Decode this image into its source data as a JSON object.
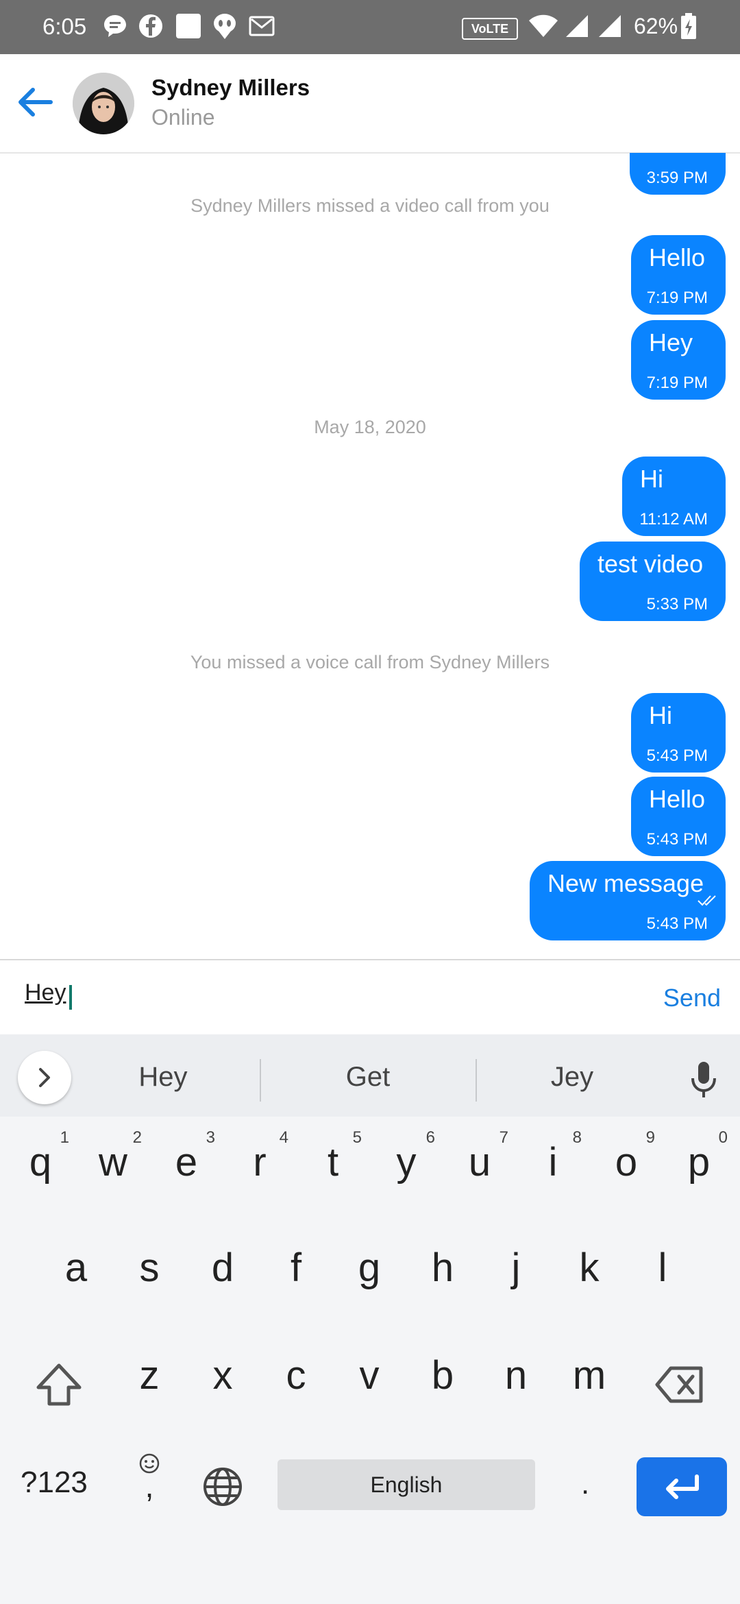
{
  "status_bar": {
    "time": "6:05",
    "network_badge": "VoLTE",
    "battery": "62%"
  },
  "header": {
    "contact_name": "Sydney Millers",
    "contact_status": "Online"
  },
  "chat": {
    "items": [
      {
        "kind": "out",
        "text": "",
        "time": "3:59 PM"
      },
      {
        "kind": "system",
        "text": "Sydney Millers missed a video call from you"
      },
      {
        "kind": "out",
        "text": "Hello",
        "time": "7:19 PM"
      },
      {
        "kind": "out",
        "text": "Hey",
        "time": "7:19 PM"
      },
      {
        "kind": "system",
        "text": "May 18, 2020"
      },
      {
        "kind": "out",
        "text": "Hi",
        "time": "11:12 AM"
      },
      {
        "kind": "out",
        "text": "test video",
        "time": "5:33 PM"
      },
      {
        "kind": "system",
        "text": "You missed a voice call from Sydney Millers"
      },
      {
        "kind": "out",
        "text": "Hi",
        "time": "5:43 PM"
      },
      {
        "kind": "out",
        "text": "Hello",
        "time": "5:43 PM"
      },
      {
        "kind": "out",
        "text": "New message",
        "time": "5:43 PM",
        "read": true
      }
    ]
  },
  "composer": {
    "value": "Hey",
    "send_label": "Send"
  },
  "keyboard": {
    "suggestions": [
      "Hey",
      "Get",
      "Jey"
    ],
    "row1": [
      "q",
      "w",
      "e",
      "r",
      "t",
      "y",
      "u",
      "i",
      "o",
      "p"
    ],
    "row1_nums": [
      "1",
      "2",
      "3",
      "4",
      "5",
      "6",
      "7",
      "8",
      "9",
      "0"
    ],
    "row2": [
      "a",
      "s",
      "d",
      "f",
      "g",
      "h",
      "j",
      "k",
      "l"
    ],
    "row3": [
      "z",
      "x",
      "c",
      "v",
      "b",
      "n",
      "m"
    ],
    "symbols_label": "?123",
    "comma_label": ",",
    "space_label": "English",
    "period_label": "."
  },
  "colors": {
    "accent": "#0a84ff",
    "status_bar": "#6e6e6e",
    "enter_key": "#1a73e8"
  }
}
